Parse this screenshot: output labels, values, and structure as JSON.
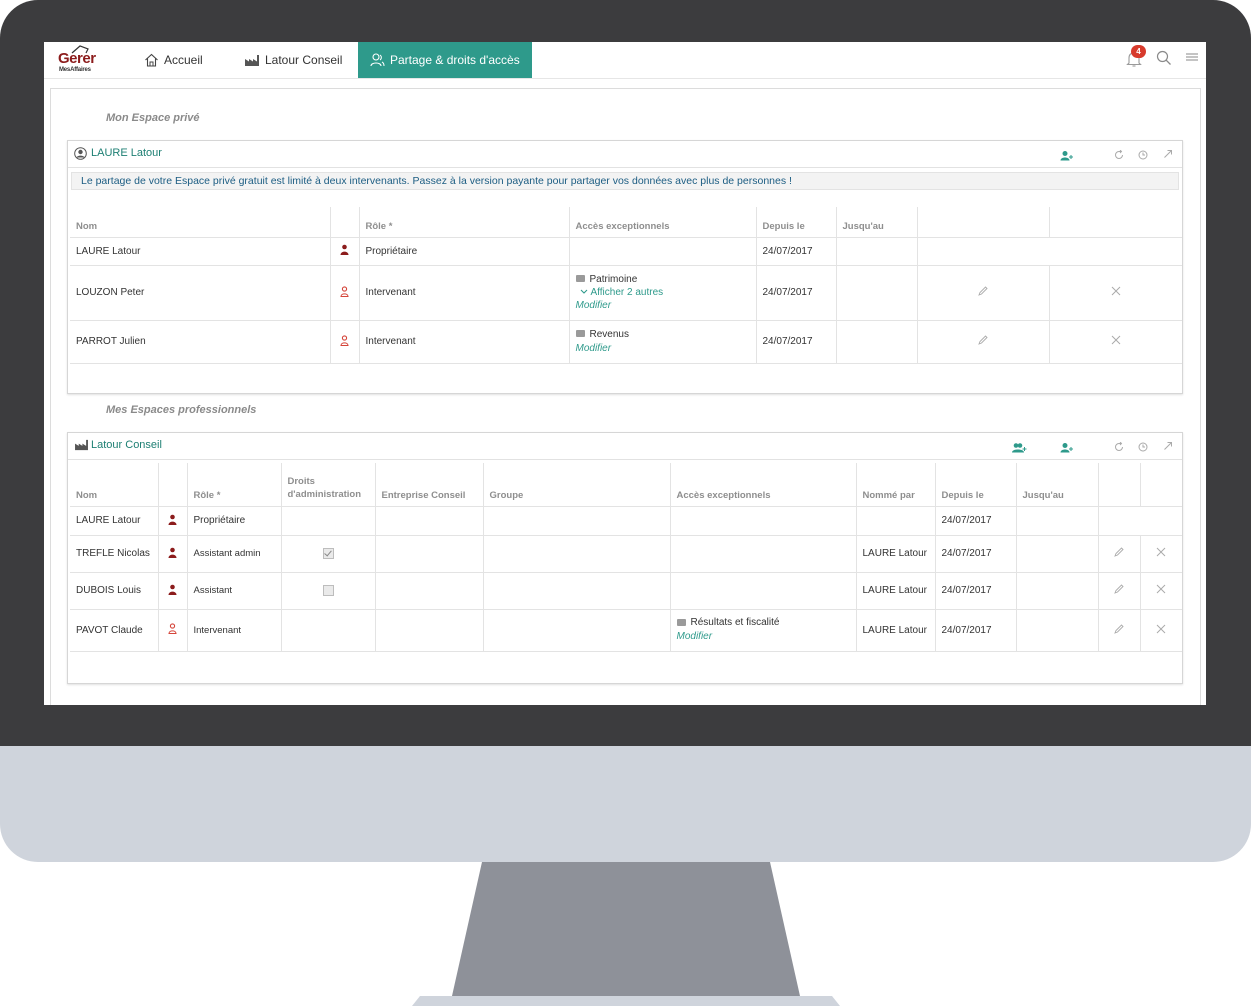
{
  "app": {
    "logo_main": "Gerer",
    "logo_sub": "MesAffaires",
    "notifications_count": "4"
  },
  "nav": {
    "home": "Accueil",
    "company": "Latour Conseil",
    "share": "Partage & droits d'accès"
  },
  "colors": {
    "accent": "#2e9a8b",
    "brand": "#8c1c1c",
    "badge": "#d73a2c",
    "monitor_bezel": "#3c3c3e",
    "monitor_chin": "#cfd4dc",
    "stand": "#8e9199"
  },
  "private": {
    "section_title": "Mon Espace privé",
    "panel_title": "LAURE Latour",
    "notice": "Le partage de votre Espace privé gratuit est limité à deux intervenants. Passez à la version payante pour partager vos données avec plus de personnes !",
    "headers": {
      "name": "Nom",
      "role": "Rôle *",
      "access": "Accès exceptionnels",
      "since": "Depuis le",
      "until": "Jusqu'au"
    },
    "rows": [
      {
        "name": "LAURE Latour",
        "role": "Propriétaire",
        "access": "",
        "more": "",
        "modify": "",
        "since": "24/07/2017"
      },
      {
        "name": "LOUZON Peter",
        "role": "Intervenant",
        "access": "Patrimoine",
        "more": "Afficher 2 autres",
        "modify": "Modifier",
        "since": "24/07/2017"
      },
      {
        "name": "PARROT Julien",
        "role": "Intervenant",
        "access": "Revenus",
        "more": "",
        "modify": "Modifier",
        "since": "24/07/2017"
      }
    ]
  },
  "pro": {
    "section_title": "Mes Espaces professionnels",
    "panel_title": "Latour Conseil",
    "headers": {
      "name": "Nom",
      "role": "Rôle *",
      "admin_line1": "Droits",
      "admin_line2": "d'administration",
      "company": "Entreprise Conseil",
      "group": "Groupe",
      "access": "Accès exceptionnels",
      "named_by": "Nommé par",
      "since": "Depuis le",
      "until": "Jusqu'au"
    },
    "rows": [
      {
        "name": "LAURE Latour",
        "role": "Propriétaire",
        "admin": "none",
        "access": "",
        "modify": "",
        "named_by": "",
        "since": "24/07/2017"
      },
      {
        "name": "TREFLE Nicolas",
        "role": "Assistant admin",
        "admin": "checked",
        "access": "",
        "modify": "",
        "named_by": "LAURE Latour",
        "since": "24/07/2017"
      },
      {
        "name": "DUBOIS Louis",
        "role": "Assistant",
        "admin": "unchecked",
        "access": "",
        "modify": "",
        "named_by": "LAURE Latour",
        "since": "24/07/2017"
      },
      {
        "name": "PAVOT Claude",
        "role": "Intervenant",
        "admin": "none",
        "access": "Résultats et fiscalité",
        "modify": "Modifier",
        "named_by": "LAURE Latour",
        "since": "24/07/2017"
      }
    ]
  }
}
